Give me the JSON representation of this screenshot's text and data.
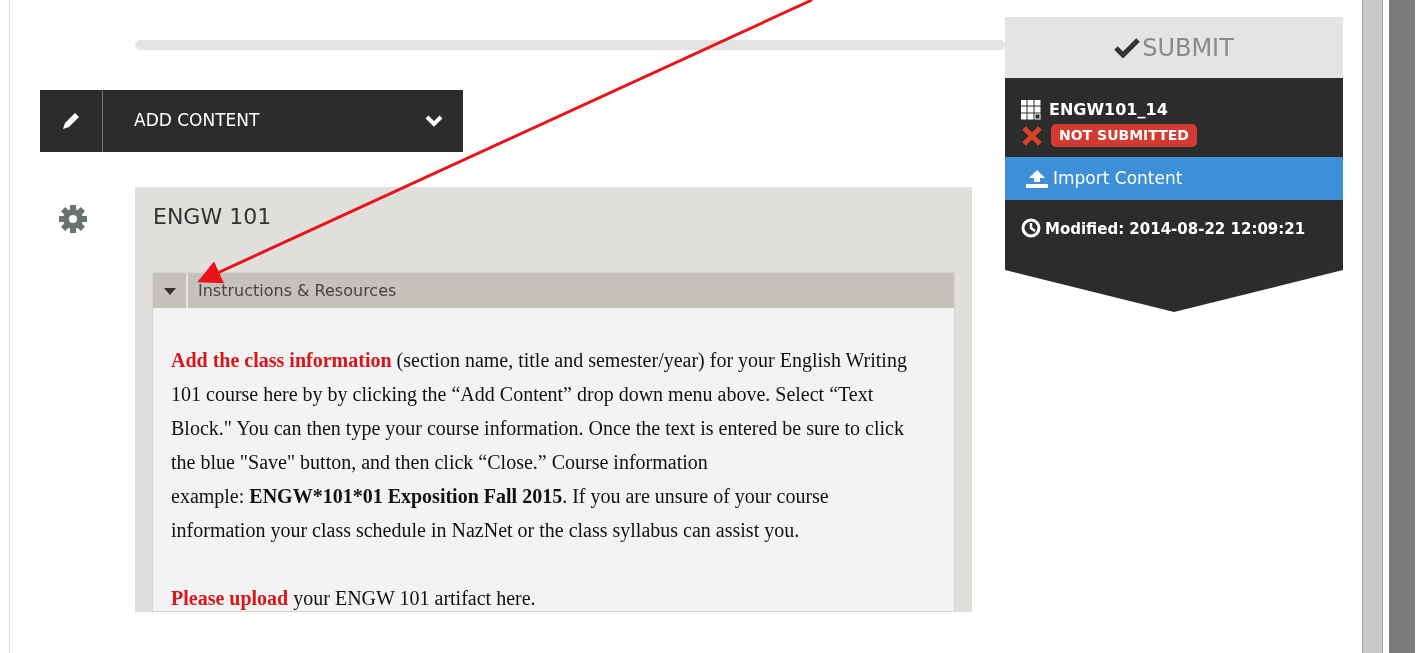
{
  "toolbar": {
    "add_content": {
      "label": "ADD CONTENT"
    }
  },
  "block": {
    "title": "ENGW 101",
    "section": {
      "title": "Instructions & Resources",
      "expanded": true,
      "paragraphs": [
        [
          {
            "kind": "highlight",
            "text": "Add the class information"
          },
          {
            "kind": "plain",
            "text": " (section name, title and semester/year) for your English Writing 101 course here by by clicking the “Add Content” drop down menu above. Select “Text Block.\" You can then type your course information. Once the text is entered be sure to click the blue \"Save\" button, and then click “Close.” Course information"
          },
          {
            "kind": "break"
          },
          {
            "kind": "plain",
            "text": "example: "
          },
          {
            "kind": "strong",
            "text": "ENGW*101*01 Exposition Fall 2015"
          },
          {
            "kind": "plain",
            "text": ". If you are unsure of your course information your class schedule in NazNet or the class syllabus can assist you."
          }
        ],
        [
          {
            "kind": "highlight",
            "text": "Please upload"
          },
          {
            "kind": "plain",
            "text": " your ENGW 101 artifact here."
          }
        ]
      ]
    }
  },
  "submission": {
    "submit": {
      "label": "SUBMIT",
      "disabled": true
    },
    "item": "ENGW101_14",
    "status": {
      "label": "NOT SUBMITTED",
      "submitted": false
    },
    "import_button": "Import Content",
    "modified": "Modified: 2014-08-22 12:09:21"
  }
}
